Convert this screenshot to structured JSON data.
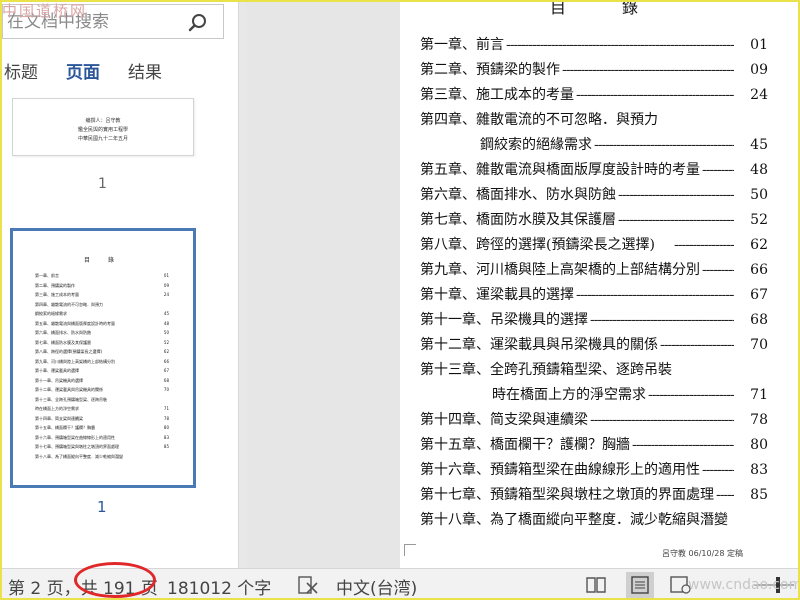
{
  "watermark": {
    "top": "中国道桥网",
    "bottom": "www.cndao.com"
  },
  "nav": {
    "search_placeholder": "在文档中搜索",
    "tabs": [
      {
        "label": "标题",
        "active": false
      },
      {
        "label": "页面",
        "active": true
      },
      {
        "label": "结果",
        "active": false
      }
    ],
    "thumb1": {
      "lines": [
        "编撰人：吕守教",
        "鑑全民與的實用工程學",
        "中華民國九十二年五月"
      ],
      "page_number": "1"
    },
    "thumb2": {
      "title": "目 錄",
      "page_number": "1"
    }
  },
  "document": {
    "title": "目　錄",
    "toc": [
      {
        "text": "第一章、前言",
        "page": "01"
      },
      {
        "text": "第二章、預鑄梁的製作",
        "page": "09"
      },
      {
        "text": "第三章、施工成本的考量",
        "page": "24"
      },
      {
        "text": "第四章、雜散電流的不可忽略．與預力",
        "page": ""
      },
      {
        "text": "鋼絞索的絕緣需求",
        "page": "45"
      },
      {
        "text": "第五章、雜散電流與橋面版厚度設計時的考量",
        "page": "48"
      },
      {
        "text": "第六章、橋面排水、防水與防蝕",
        "page": "50"
      },
      {
        "text": "第七章、橋面防水膜及其保護層",
        "page": "52"
      },
      {
        "text": "第八章、跨徑的選擇(預鑄梁長之選擇)",
        "page": "62"
      },
      {
        "text": "第九章、河川橋與陸上高架橋的上部結構分別",
        "page": "66"
      },
      {
        "text": "第十章、運梁載具的選擇",
        "page": "67"
      },
      {
        "text": "第十一章、吊梁機具的選擇",
        "page": "68"
      },
      {
        "text": "第十二章、運梁載具與吊梁機具的關係",
        "page": "70"
      },
      {
        "text": "第十三章、全跨孔預鑄箱型梁、逐跨吊裝",
        "page": ""
      },
      {
        "text": "時在橋面上方的淨空需求",
        "page": "71"
      },
      {
        "text": "第十四章、简支梁與連續梁",
        "page": "78"
      },
      {
        "text": "第十五章、橋面欄干？護欄？胸牆",
        "page": "80"
      },
      {
        "text": "第十六章、預鑄箱型梁在曲線線形上的適用性",
        "page": "83"
      },
      {
        "text": "第十七章、預鑄箱型梁與墩柱之墩頂的界面處理",
        "page": "85"
      },
      {
        "text": "第十八章、為了橋面縱向平整度．減少乾縮與潛變",
        "page": ""
      }
    ],
    "footer": "呂守教 06/10/28 定稿"
  },
  "status_bar": {
    "page_count": "第 2 页，共 191 页",
    "word_count": "181012 个字",
    "language": "中文(台湾)"
  },
  "colors": {
    "accent": "#2b579a",
    "highlight_oval": "#e0282a",
    "frame": "#e9e24a"
  }
}
